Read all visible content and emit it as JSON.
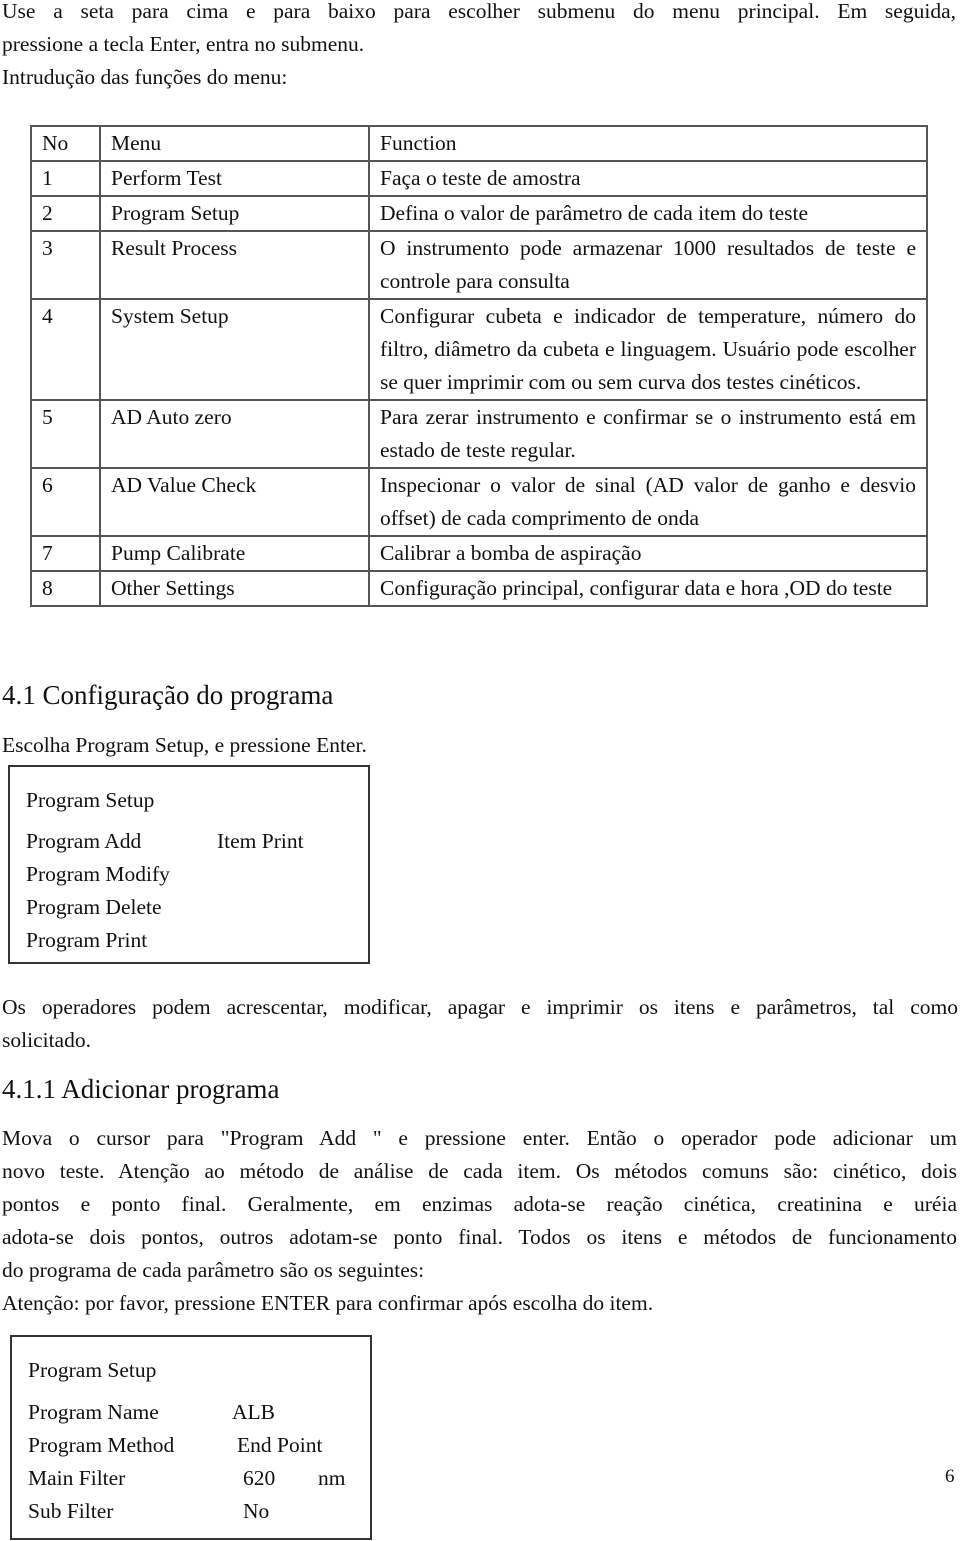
{
  "intro": {
    "line1": "Use a seta para cima e para baixo para escolher submenu do menu principal. Em seguida,",
    "line2": "pressione a tecla Enter, entra no submenu.",
    "line3": "Intrudução das funções do menu:"
  },
  "menu_table": {
    "headers": {
      "no": "No",
      "menu": "Menu",
      "function": "Function"
    },
    "rows": [
      {
        "no": "1",
        "menu": "Perform Test",
        "function": "Faça o teste de amostra"
      },
      {
        "no": "2",
        "menu": "Program Setup",
        "function": "Defina o valor de parâmetro de cada item do teste"
      },
      {
        "no": "3",
        "menu": "Result Process",
        "function": "O instrumento pode armazenar 1000 resultados de teste e controle para consulta"
      },
      {
        "no": "4",
        "menu": "System Setup",
        "function": "Configurar cubeta e indicador de temperature, número do filtro, diâmetro da cubeta e linguagem. Usuário pode escolher se quer imprimir com ou sem curva dos testes cinéticos."
      },
      {
        "no": "5",
        "menu": "AD Auto zero",
        "function": "Para zerar instrumento e confirmar se o instrumento está em estado de teste regular."
      },
      {
        "no": "6",
        "menu": "AD Value Check",
        "function": "Inspecionar o valor de sinal (AD valor de ganho e desvio offset) de cada comprimento de onda"
      },
      {
        "no": "7",
        "menu": "Pump Calibrate",
        "function": "Calibrar a bomba de aspiração"
      },
      {
        "no": "8",
        "menu": "Other Settings",
        "function": "Configuração principal, configurar data e hora ,OD do teste"
      }
    ]
  },
  "section_4_1": {
    "heading": "4.1 Configuração do programa",
    "instruction": "Escolha Program Setup, e pressione Enter.",
    "screen": {
      "title": "Program Setup",
      "items": [
        "Program Add",
        "Program Modify",
        "Program Delete",
        "Program Print"
      ],
      "side_item": "Item Print"
    },
    "description_line1": "Os operadores podem acrescentar, modificar, apagar e imprimir os itens e parâmetros, tal como",
    "description_line2": "solicitado."
  },
  "section_4_1_1": {
    "heading": "4.1.1 Adicionar programa",
    "lines": [
      "Mova o cursor para \"Program Add \" e pressione enter. Então o operador pode adicionar um",
      "novo teste. Atenção ao método de análise de cada item. Os métodos comuns são: cinético, dois",
      "pontos e ponto final. Geralmente, em enzimas adota-se reação cinética, creatinina e uréia",
      "adota-se dois pontos, outros adotam-se ponto final. Todos os itens e métodos de funcionamento",
      "do programa de cada parâmetro são os seguintes:"
    ],
    "attention": "Atenção: por favor, pressione ENTER para confirmar após escolha do item.",
    "screen": {
      "title": "Program Setup",
      "rows": [
        {
          "label": "Program Name",
          "value": "ALB",
          "unit": ""
        },
        {
          "label": "Program Method",
          "value": "End Point",
          "unit": ""
        },
        {
          "label": "Main Filter",
          "value": "620",
          "unit": "nm"
        },
        {
          "label": "Sub Filter",
          "value": "No",
          "unit": ""
        }
      ]
    }
  },
  "page_number": "6"
}
